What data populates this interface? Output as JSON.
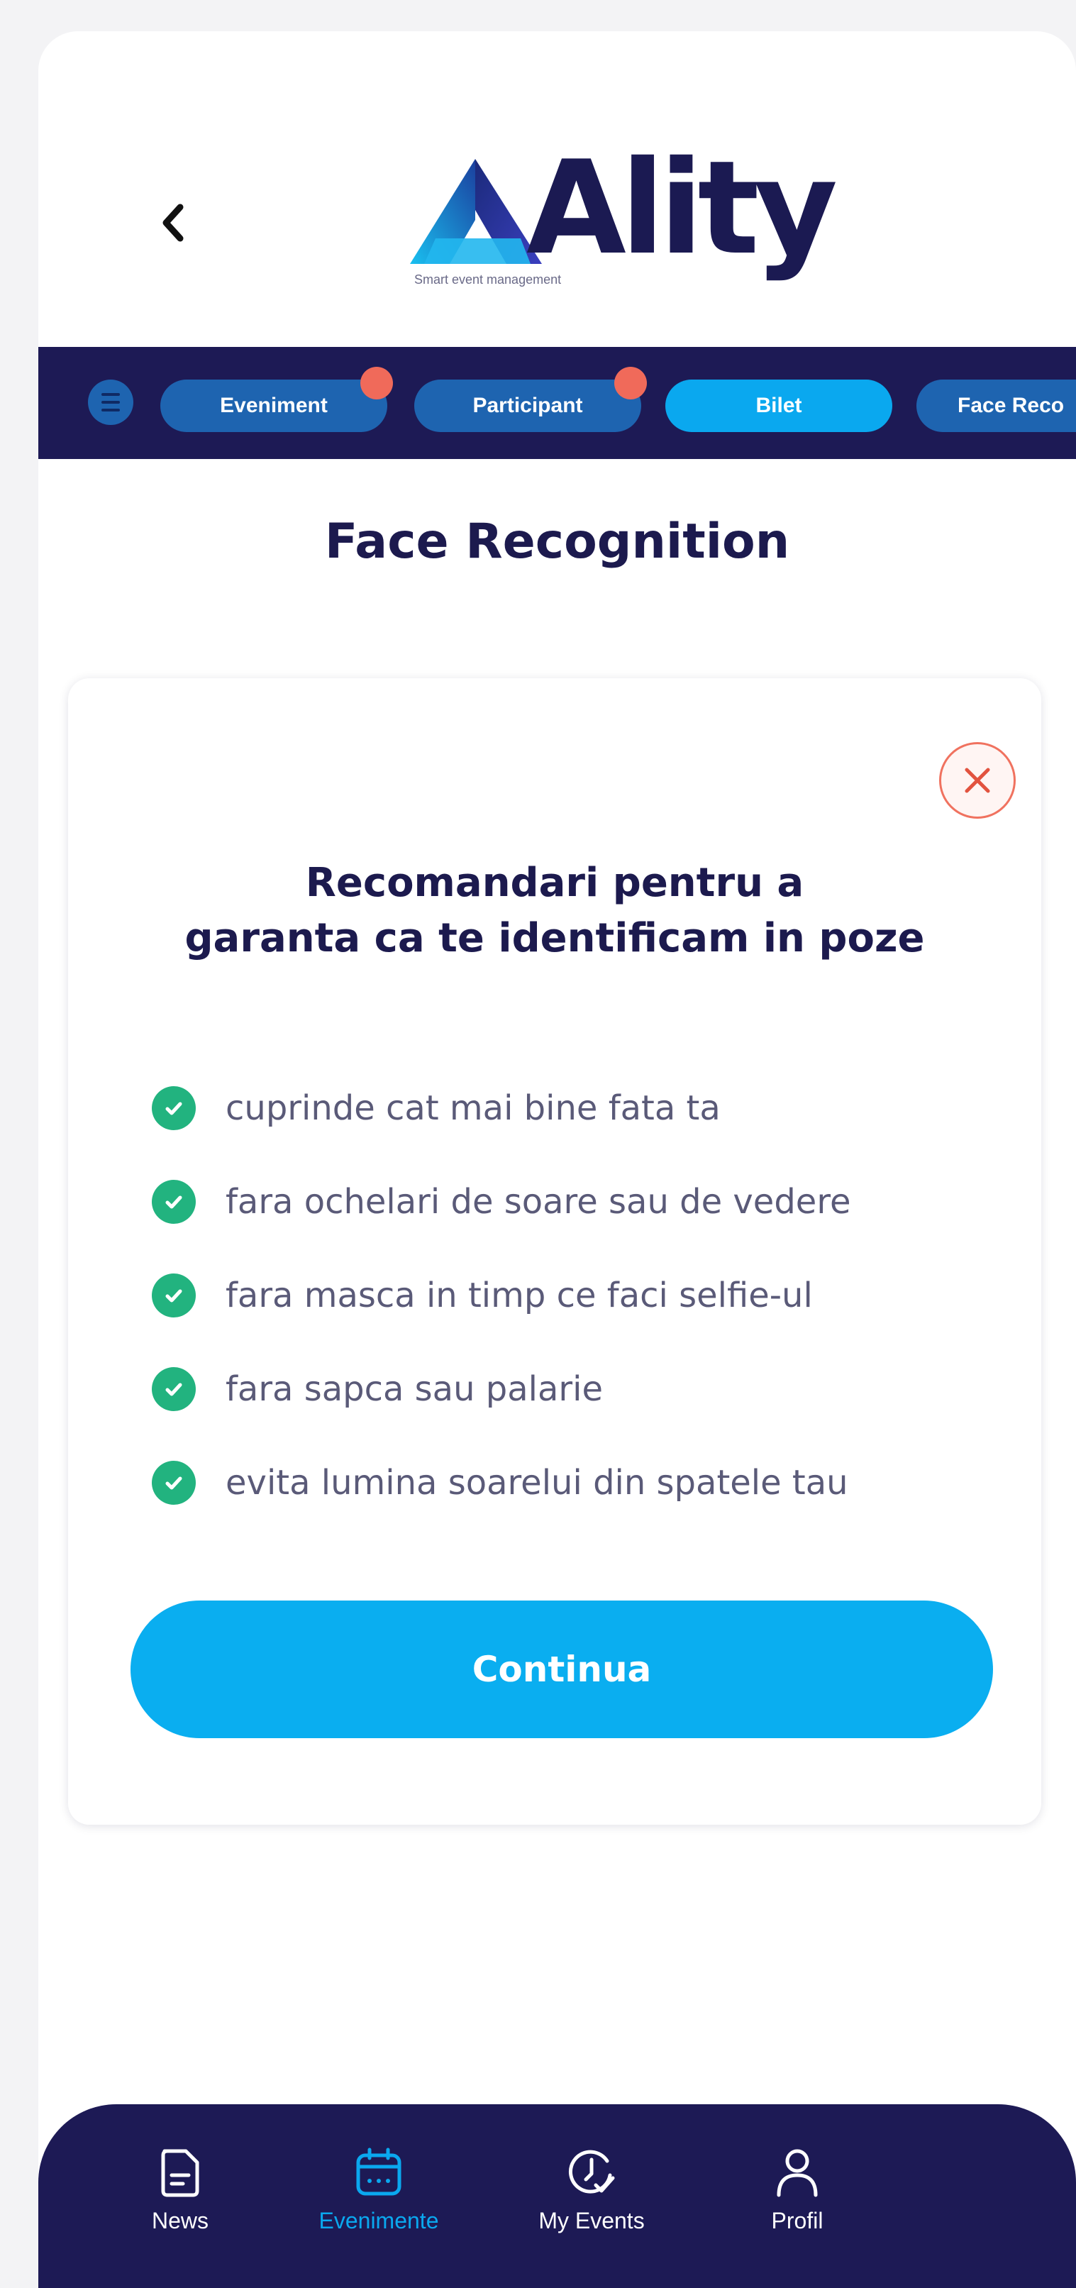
{
  "header": {
    "back_icon": "chevron-left-icon",
    "logo_text": "Ality",
    "logo_tagline": "Smart event management"
  },
  "tabs": {
    "menu_icon": "menu-icon",
    "items": [
      {
        "label": "Eveniment",
        "has_dot": true,
        "active": false
      },
      {
        "label": "Participant",
        "has_dot": true,
        "active": false
      },
      {
        "label": "Bilet",
        "has_dot": false,
        "active": true
      },
      {
        "label": "Face Reco",
        "has_dot": false,
        "active": false
      }
    ]
  },
  "page": {
    "title": "Face Recognition"
  },
  "card": {
    "close_icon": "close-icon",
    "title_line1": "Recomandari pentru a",
    "title_line2": "garanta ca te identificam in poze",
    "recommendations": [
      "cuprinde cat mai bine fata ta",
      "fara ochelari de soare sau de vedere",
      "fara masca in timp ce faci selfie-ul",
      "fara sapca sau palarie",
      "evita lumina soarelui din spatele tau"
    ],
    "continue_label": "Continua"
  },
  "bottom_nav": {
    "items": [
      {
        "label": "News",
        "icon": "news-icon",
        "active": false
      },
      {
        "label": "Evenimente",
        "icon": "calendar-icon",
        "active": true
      },
      {
        "label": "My Events",
        "icon": "clock-check-icon",
        "active": false
      },
      {
        "label": "Profil",
        "icon": "profile-icon",
        "active": false
      }
    ]
  },
  "colors": {
    "navy": "#1d1a55",
    "accent": "#0aa8ef",
    "tab": "#1e64b0",
    "notification": "#f06a5a",
    "check": "#22b37f",
    "close": "#f0725f"
  }
}
